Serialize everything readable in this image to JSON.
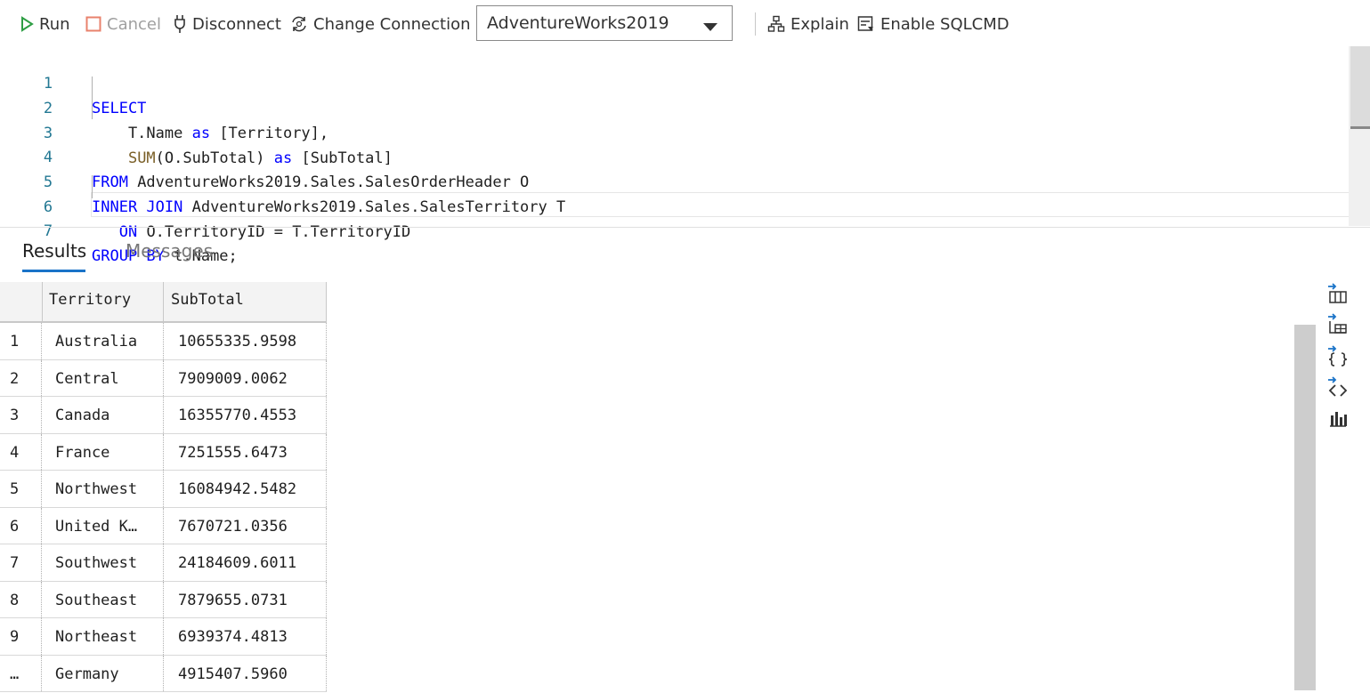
{
  "toolbar": {
    "run": "Run",
    "cancel": "Cancel",
    "disconnect": "Disconnect",
    "change_connection": "Change Connection",
    "database": "AdventureWorks2019",
    "explain": "Explain",
    "sqlcmd": "Enable SQLCMD"
  },
  "editor": {
    "line_numbers": [
      "1",
      "2",
      "3",
      "4",
      "5",
      "6",
      "7"
    ]
  },
  "tabs": {
    "results": "Results",
    "messages": "Messages"
  },
  "grid": {
    "columns": [
      "Territory",
      "SubTotal"
    ],
    "rows": [
      {
        "num": "1",
        "territory": "Australia",
        "subtotal": "10655335.9598"
      },
      {
        "num": "2",
        "territory": "Central",
        "subtotal": "7909009.0062"
      },
      {
        "num": "3",
        "territory": "Canada",
        "subtotal": "16355770.4553"
      },
      {
        "num": "4",
        "territory": "France",
        "subtotal": "7251555.6473"
      },
      {
        "num": "5",
        "territory": "Northwest",
        "subtotal": "16084942.5482"
      },
      {
        "num": "6",
        "territory": "United K…",
        "subtotal": "7670721.0356"
      },
      {
        "num": "7",
        "territory": "Southwest",
        "subtotal": "24184609.6011"
      },
      {
        "num": "8",
        "territory": "Southeast",
        "subtotal": "7879655.0731"
      },
      {
        "num": "9",
        "territory": "Northeast",
        "subtotal": "6939374.4813"
      },
      {
        "num": "…",
        "territory": "Germany",
        "subtotal": "4915407.5960"
      }
    ]
  },
  "icons": {
    "run": "play-icon",
    "cancel": "stop-icon",
    "disconnect": "plug-icon",
    "change_connection": "refresh-connection-icon",
    "explain": "hierarchy-icon",
    "sqlcmd": "sqlcmd-icon",
    "side": [
      "save-csv-icon",
      "save-excel-icon",
      "save-json-icon",
      "save-xml-icon",
      "chart-icon"
    ]
  },
  "colors": {
    "keyword": "#0000ff",
    "function": "#795e26",
    "line_number": "#237893",
    "run_icon": "#2e9e44",
    "cancel_icon": "#e8826c",
    "tab_underline": "#1a73c8"
  }
}
